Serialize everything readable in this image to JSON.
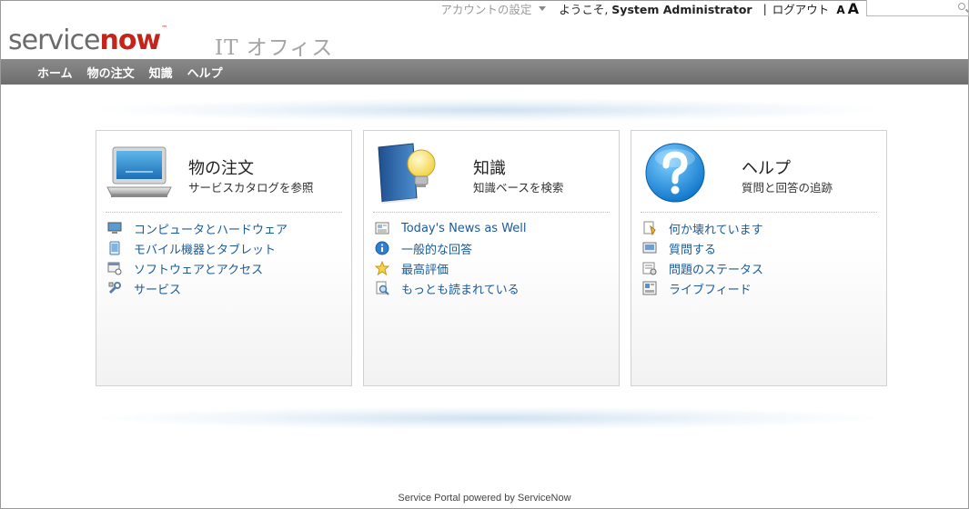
{
  "header": {
    "account_settings": "アカウントの設定",
    "welcome_prefix": "ようこそ, ",
    "user_name": "System Administrator",
    "separator": "|",
    "logout": "ログアウト",
    "font_small": "A",
    "font_large": "A",
    "search": {
      "value": "",
      "placeholder": ""
    }
  },
  "logo": {
    "brand_service": "service",
    "brand_now": "now",
    "trademark": "™",
    "subtitle": "IT オフィス",
    "brand_colors": {
      "grey": "#6b6b6b",
      "red": "#c4241a"
    }
  },
  "nav": {
    "items": [
      {
        "label": "ホーム"
      },
      {
        "label": "物の注文"
      },
      {
        "label": "知識"
      },
      {
        "label": "ヘルプ"
      }
    ],
    "background": "#777777"
  },
  "panels": [
    {
      "title": "物の注文",
      "subtitle": "サービスカタログを参照",
      "icon": "laptop-icon",
      "links": [
        {
          "label": "コンピュータとハードウェア",
          "icon": "monitor-icon"
        },
        {
          "label": "モバイル機器とタブレット",
          "icon": "tablet-icon"
        },
        {
          "label": "ソフトウェアとアクセス",
          "icon": "software-icon"
        },
        {
          "label": "サービス",
          "icon": "wrench-icon"
        }
      ]
    },
    {
      "title": "知識",
      "subtitle": "知識ベースを検索",
      "icon": "book-bulb-icon",
      "links": [
        {
          "label": "Today's News as Well",
          "icon": "news-icon"
        },
        {
          "label": "一般的な回答",
          "icon": "info-icon"
        },
        {
          "label": "最高評価",
          "icon": "star-icon"
        },
        {
          "label": "もっとも読まれている",
          "icon": "magnifier-doc-icon"
        }
      ]
    },
    {
      "title": "ヘルプ",
      "subtitle": "質問と回答の追跡",
      "icon": "help-question-icon",
      "links": [
        {
          "label": "何か壊れています",
          "icon": "broken-doc-icon"
        },
        {
          "label": "質問する",
          "icon": "ask-icon"
        },
        {
          "label": "問題のステータス",
          "icon": "status-icon"
        },
        {
          "label": "ライブフィード",
          "icon": "live-feed-icon"
        }
      ]
    }
  ],
  "link_color": "#1b5a9a",
  "footer": {
    "text": "Service Portal powered by ServiceNow"
  }
}
